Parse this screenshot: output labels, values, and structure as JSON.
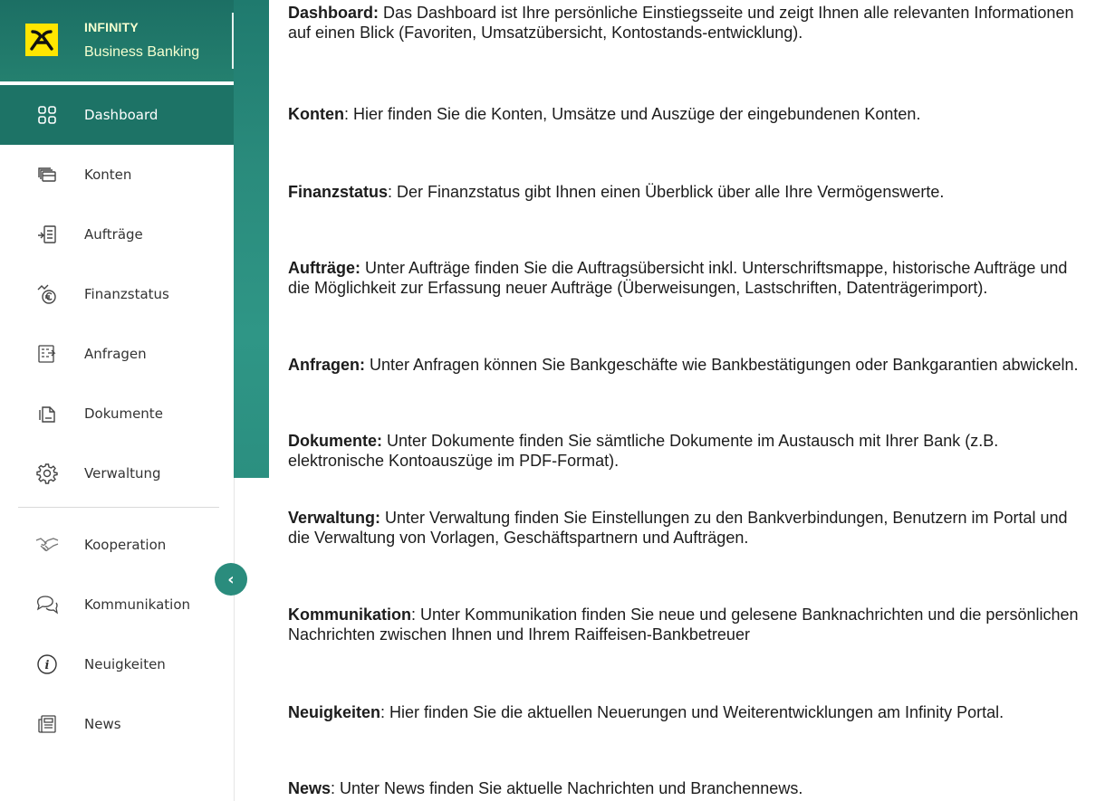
{
  "brand": {
    "line1": "INFINITY",
    "line2": "Business Banking"
  },
  "nav": {
    "dashboard": "Dashboard",
    "konten": "Konten",
    "auftraege": "Aufträge",
    "finanzstatus": "Finanzstatus",
    "anfragen": "Anfragen",
    "dokumente": "Dokumente",
    "verwaltung": "Verwaltung",
    "kooperation": "Kooperation",
    "kommunikation": "Kommunikation",
    "neuigkeiten": "Neuigkeiten",
    "news": "News"
  },
  "collapse_glyph": "‹",
  "descriptions": {
    "dashboard": {
      "title": "Dashboard:",
      "text": " Das Dashboard ist Ihre persönliche Einstiegsseite und zeigt Ihnen alle relevanten Informationen auf einen Blick (Favoriten, Umsatzübersicht, Kontostands-entwicklung)."
    },
    "konten": {
      "title": "Konten",
      "text": ": Hier finden Sie die Konten, Umsätze und Auszüge der eingebundenen Konten."
    },
    "finanzstatus": {
      "title": "Finanzstatus",
      "text": ": Der Finanzstatus gibt Ihnen einen Überblick über alle Ihre Vermögenswerte."
    },
    "auftraege": {
      "title": "Aufträge:",
      "text": " Unter Aufträge finden Sie die Auftragsübersicht inkl. Unterschriftsmappe, historische Aufträge und die Möglichkeit zur Erfassung neuer Aufträge (Überweisungen, Lastschriften, Datenträgerimport)."
    },
    "anfragen": {
      "title": "Anfragen:",
      "text": " Unter Anfragen können Sie Bankgeschäfte wie Bankbestätigungen oder Bankgarantien abwickeln."
    },
    "dokumente": {
      "title": "Dokumente:",
      "text": " Unter Dokumente finden Sie sämtliche Dokumente im Austausch mit Ihrer Bank (z.B. elektronische Kontoauszüge im PDF-Format)."
    },
    "verwaltung": {
      "title": "Verwaltung:",
      "text": " Unter Verwaltung finden Sie Einstellungen zu den Bankverbindungen, Benutzern im Portal und die Verwaltung von Vorlagen, Geschäftspartnern und Aufträgen."
    },
    "kommunikation": {
      "title": "Kommunikation",
      "text": ": Unter Kommunikation finden Sie neue und gelesene Banknachrichten und die persönlichen Nachrichten zwischen Ihnen und Ihrem Raiffeisen-Bankbetreuer"
    },
    "neuigkeiten": {
      "title": "Neuigkeiten",
      "text": ": Hier finden Sie die aktuellen Neuerungen und Weiterentwicklungen am Infinity Portal."
    },
    "news": {
      "title": "News",
      "text": ": Unter News finden Sie aktuelle Nachrichten und Branchennews."
    }
  }
}
